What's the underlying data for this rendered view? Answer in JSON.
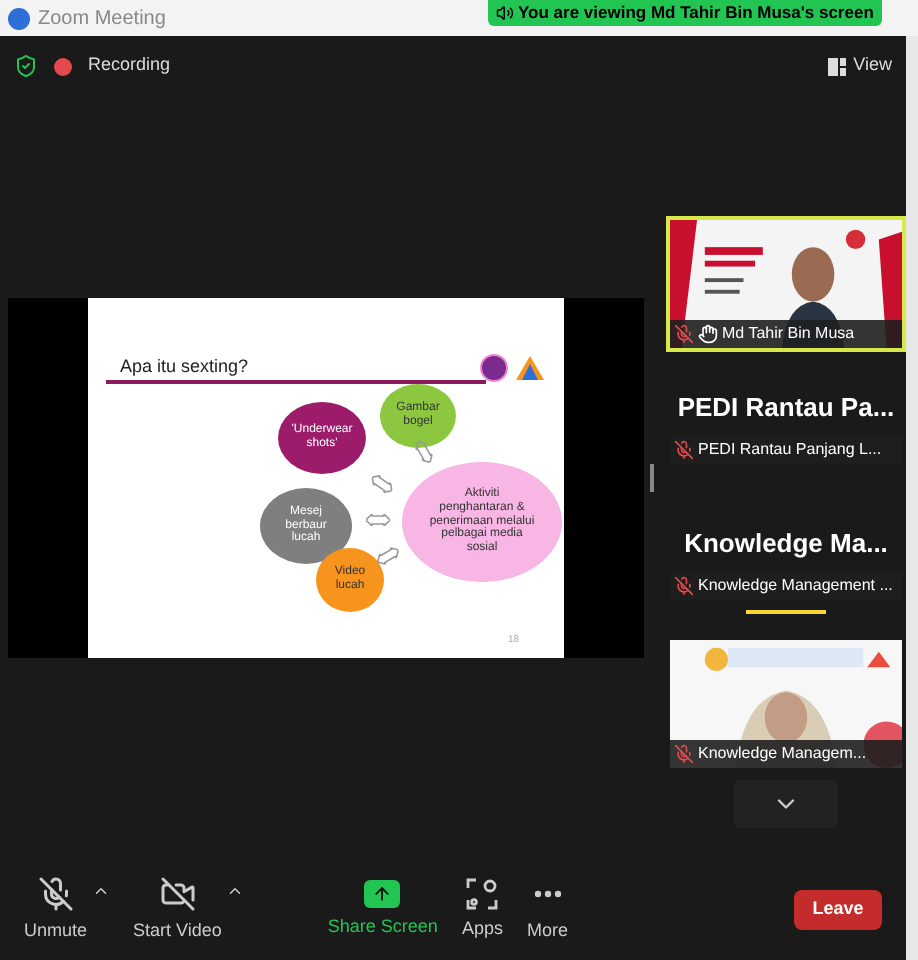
{
  "window": {
    "title": "Zoom Meeting"
  },
  "banner": "You are viewing Md Tahir Bin Musa's screen",
  "top_bar": {
    "recording": "Recording",
    "view": "View"
  },
  "slide": {
    "title": "Apa itu sexting?",
    "page": "18",
    "bubbles": [
      {
        "text": "'Underwear\nshots'",
        "color": "#9c1c6b"
      },
      {
        "text": "Gambar\nbogel",
        "color": "#8dc63f"
      },
      {
        "text": "Mesej\nberbaur\nlucah",
        "color": "#7f7f7f"
      },
      {
        "text": "Video\nlucah",
        "color": "#f7941d"
      },
      {
        "text": "Aktiviti\npenghantaran &\npenerimaan melalui\npelbagai media\nsosial",
        "color": "#f7b6e4"
      }
    ]
  },
  "participants": [
    {
      "kind": "video",
      "name": "Md Tahir Bin Musa",
      "active": true,
      "speaking": false
    },
    {
      "kind": "name",
      "big": "PEDI Rantau Pa...",
      "name": "PEDI Rantau Panjang L...",
      "active": false,
      "speaking": false
    },
    {
      "kind": "name",
      "big": "Knowledge Ma...",
      "name": "Knowledge Management ...",
      "active": false,
      "speaking": true
    },
    {
      "kind": "video",
      "name": "Knowledge Managem...",
      "active": false,
      "speaking": false
    }
  ],
  "toolbar": [
    {
      "kind": "mic",
      "label": "Unmute"
    },
    {
      "kind": "video",
      "label": "Start Video"
    },
    {
      "kind": "share",
      "label": "Share Screen"
    },
    {
      "kind": "apps",
      "label": "Apps"
    },
    {
      "kind": "more",
      "label": "More"
    }
  ],
  "leave": "Leave"
}
